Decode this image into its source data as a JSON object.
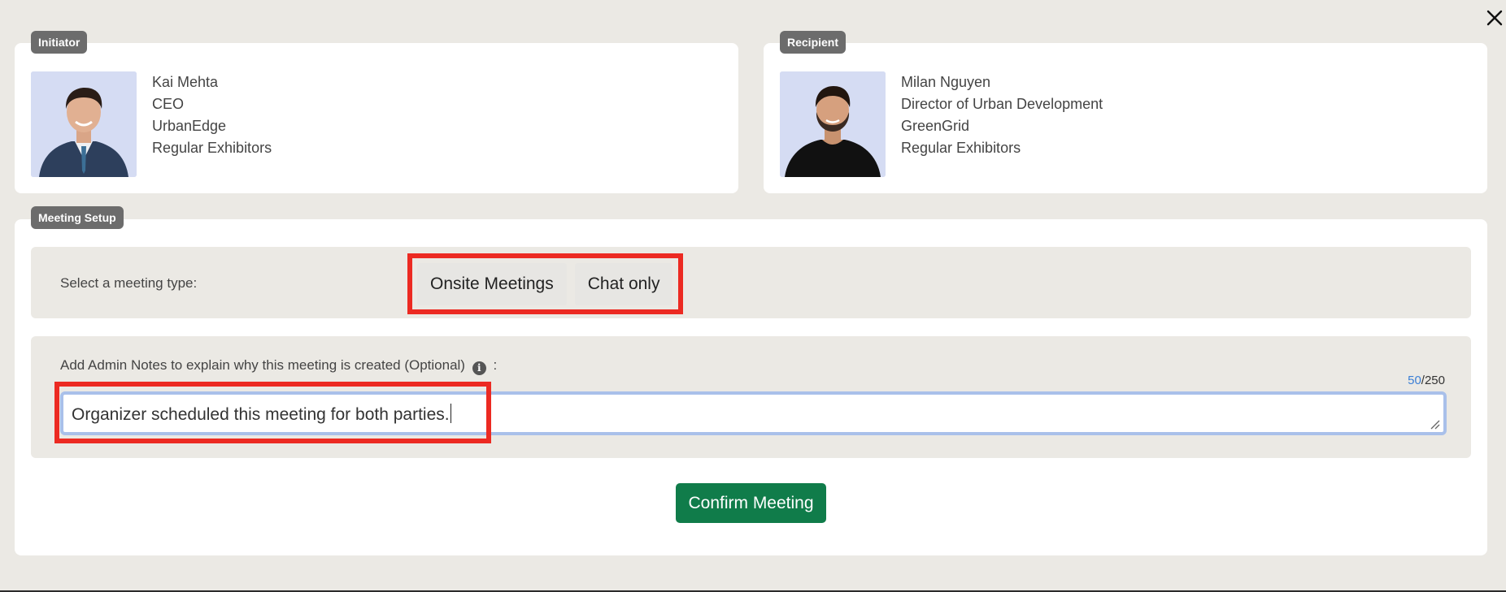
{
  "initiator": {
    "tag": "Initiator",
    "name": "Kai Mehta",
    "title": "CEO",
    "company": "UrbanEdge",
    "group": "Regular Exhibitors"
  },
  "recipient": {
    "tag": "Recipient",
    "name": "Milan Nguyen",
    "title": "Director of Urban Development",
    "company": "GreenGrid",
    "group": "Regular Exhibitors"
  },
  "meeting_setup": {
    "tag": "Meeting Setup",
    "type_label": "Select a meeting type:",
    "types": [
      "Onsite Meetings",
      "Chat only"
    ],
    "notes_label": "Add Admin Notes to explain why this meeting is created (Optional)",
    "notes_label_suffix": ":",
    "info_icon_glyph": "i",
    "notes_value": "Organizer scheduled this meeting for both parties.",
    "char_count": "50",
    "char_max": "/250",
    "confirm_label": "Confirm Meeting"
  },
  "colors": {
    "brand_green": "#107c4a",
    "highlight_red": "#ec2a22",
    "focus_blue": "#a9c0ea",
    "counter_blue": "#3b7fd6"
  }
}
